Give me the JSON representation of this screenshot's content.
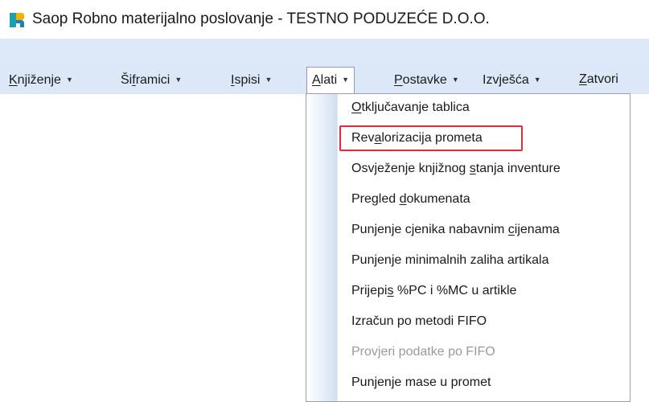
{
  "window": {
    "title": "Saop  Robno materijalno poslovanje - TESTNO PODUZEĆE D.O.O.",
    "app_icon": "saop-app-icon"
  },
  "menubar": {
    "items": [
      {
        "pre": "",
        "ul": "K",
        "post": "njiženje",
        "caret": "▼"
      },
      {
        "pre": "Ši",
        "ul": "f",
        "post": "ramici",
        "caret": "▼"
      },
      {
        "pre": "",
        "ul": "I",
        "post": "spisi",
        "caret": "▼"
      },
      {
        "pre": "",
        "ul": "A",
        "post": "lati",
        "caret": "▼"
      },
      {
        "pre": "",
        "ul": "P",
        "post": "ostavke",
        "caret": "▼"
      },
      {
        "pre": "",
        "ul": "",
        "post": "Izvješća",
        "caret": "▼"
      },
      {
        "pre": "",
        "ul": "Z",
        "post": "atvori",
        "caret": ""
      }
    ]
  },
  "dropdown": {
    "open_menu": "Alati",
    "items": [
      {
        "pre": "",
        "ul": "O",
        "post": "tključavanje tablica",
        "disabled": false
      },
      {
        "pre": "Rev",
        "ul": "a",
        "post": "lorizacija prometa",
        "disabled": false
      },
      {
        "pre": "Osvježenje knjižnog ",
        "ul": "s",
        "post": "tanja inventure",
        "disabled": false
      },
      {
        "pre": "Pregled ",
        "ul": "d",
        "post": "okumenata",
        "disabled": false
      },
      {
        "pre": "Punjenje cjenika nabavnim ",
        "ul": "c",
        "post": "ijenama",
        "disabled": false
      },
      {
        "pre": "Punjenje minimalnih zaliha artikala",
        "ul": "",
        "post": "",
        "disabled": false
      },
      {
        "pre": "Prijepi",
        "ul": "s",
        "post": " %PC i %MC u artikle",
        "disabled": false
      },
      {
        "pre": "Izračun po metodi FIFO",
        "ul": "",
        "post": "",
        "disabled": false
      },
      {
        "pre": "Provjeri podatke po FIFO",
        "ul": "",
        "post": "",
        "disabled": true
      },
      {
        "pre": "Punjenje mase u promet",
        "ul": "",
        "post": "",
        "disabled": false
      }
    ],
    "highlighted_index": 1
  },
  "colors": {
    "menubar_bg": "#dce8f7",
    "highlight_border": "#e02c3a",
    "disabled_text": "#9a9a9a"
  }
}
